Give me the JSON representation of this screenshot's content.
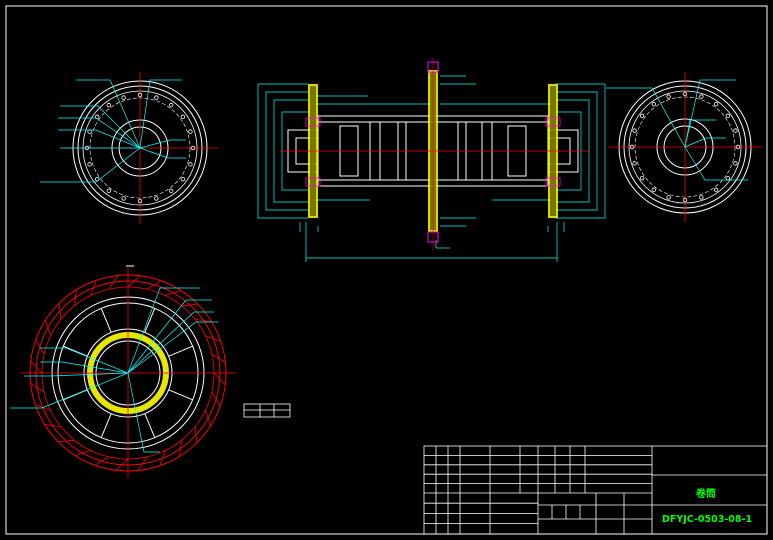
{
  "title_block": {
    "drawing_title": "卷筒",
    "drawing_number": "DFYJC-0503-08-1"
  },
  "side_view_left": {
    "label_holes": "20-M16深30孔",
    "label_holes_right": "4-Φ7孔深30孔",
    "label_slots": "4-M8-7H",
    "dims": [
      "Φ460",
      "Φ380",
      "Φ300",
      "Φ200",
      "M12",
      "150"
    ]
  },
  "side_view_right": {
    "label_holes": "20-M16深30孔",
    "label_holes_right": "4-Φ7孔",
    "label_bottom": "4-M12深30孔",
    "dims": [
      "Φ460",
      "Φ300",
      "Φ200"
    ]
  },
  "front_view": {
    "dims_top": [
      "1160",
      "690",
      "20",
      "60",
      "1780",
      "45"
    ],
    "dims_vertical": [
      "Φ460",
      "Φ380",
      "Φ300",
      "Φ200",
      "Φ160",
      "Φ150"
    ],
    "dim_overall": "3514",
    "dims_bottom": [
      "400",
      "400",
      "40",
      "44",
      "11",
      "45"
    ]
  },
  "section_view": {
    "label_top": "8-M16深30孔",
    "label_left": "4-M20-7H",
    "dims": [
      "Φ1360",
      "Φ1300",
      "Φ1160",
      "Φ960",
      "Φ920",
      "Φ800",
      "Φ460",
      "Φ300",
      "50"
    ]
  },
  "colors": {
    "background": "#000000",
    "frame": "#ffffff",
    "outline": "#ffffff",
    "dimension": "#00ffff",
    "label": "#00ff00",
    "centerline": "#ff0000",
    "hatch": "#ffff00",
    "highlight": "#ff00ff"
  }
}
